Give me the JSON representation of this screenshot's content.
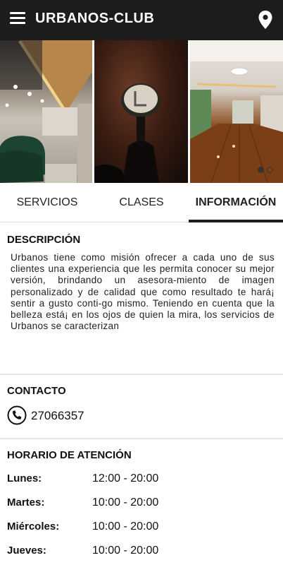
{
  "app": {
    "title": "URBANOS-CLUB"
  },
  "icons": {
    "menu": "menu-icon",
    "location": "location-pin-icon",
    "phone": "phone-icon"
  },
  "carousel": {
    "active_index": 0,
    "page_count": 2
  },
  "tabs": [
    {
      "label": "SERVICIOS",
      "active": false
    },
    {
      "label": "CLASES",
      "active": false
    },
    {
      "label": "INFORMACIÓN",
      "active": true
    }
  ],
  "descripcion": {
    "title": "DESCRIPCIÓN",
    "text": "Urbanos tiene como misión ofrecer a cada uno de sus clientes una experiencia que les permita conocer su mejor versión, brindando un asesora-miento de imagen personalizado y de calidad que como resultado te hará¡ sentir a gusto conti-go mismo. Teniendo en cuenta que la belleza está¡ en los ojos de quien la mira, los servicios de Urbanos se caracterizan"
  },
  "contacto": {
    "title": "CONTACTO",
    "phone": "27066357"
  },
  "horario": {
    "title": "HORARIO DE ATENCIÓN",
    "rows": [
      {
        "day": "Lunes:",
        "time": "12:00 - 20:00"
      },
      {
        "day": "Martes:",
        "time": "10:00 - 20:00"
      },
      {
        "day": "Miércoles:",
        "time": "10:00 - 20:00"
      },
      {
        "day": "Jueves:",
        "time": "10:00 - 20:00"
      }
    ]
  }
}
